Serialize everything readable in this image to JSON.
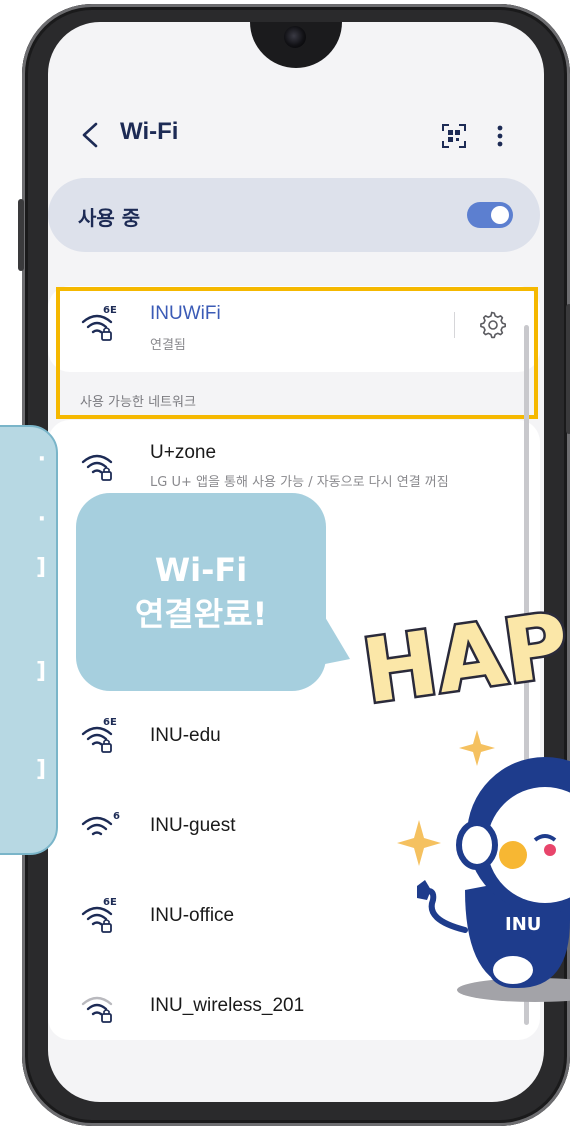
{
  "header": {
    "title": "Wi-Fi"
  },
  "usage": {
    "label": "사용 중",
    "enabled": true
  },
  "connected": {
    "name": "INUWiFi",
    "status": "연결됨",
    "badge": "6E"
  },
  "section": {
    "available_label": "사용 가능한 네트워크"
  },
  "networks": [
    {
      "name": "U+zone",
      "sub": "LG U+ 앱을 통해 사용 가능 / 자동으로 다시 연결 꺼짐",
      "badge": ""
    },
    {
      "name": "INU-edu",
      "badge": "6E"
    },
    {
      "name": "INU-guest",
      "badge": "6"
    },
    {
      "name": "INU-office",
      "badge": "6E"
    },
    {
      "name": "INU_wireless_201",
      "badge": ""
    }
  ],
  "overlay": {
    "bubble_line1": "Wi-Fi",
    "bubble_line2": "연결완료!",
    "happy_text": "HAP",
    "mascot_logo": "INU"
  },
  "colors": {
    "accent": "#5c7fd0",
    "highlight": "#f5b800",
    "bubble": "#a6cfde",
    "title": "#1d2b55"
  },
  "icons": [
    "back-icon",
    "qr-scan-icon",
    "more-icon",
    "wifi-lock-icon",
    "settings-gear-icon"
  ]
}
